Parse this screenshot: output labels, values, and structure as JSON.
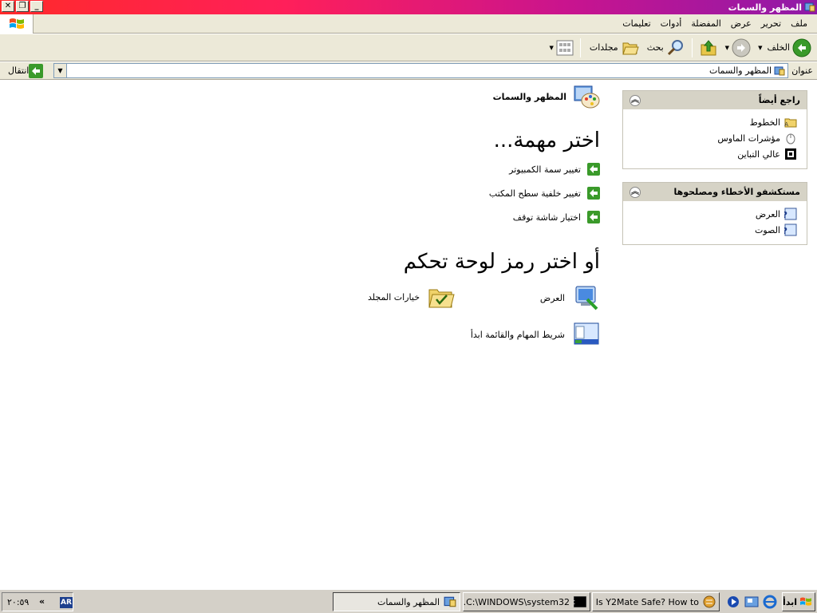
{
  "window": {
    "title": "المظهر والسمات",
    "buttons": [
      "_",
      "❐",
      "✕"
    ]
  },
  "menu": {
    "items": [
      "ملف",
      "تحرير",
      "عرض",
      "المفضلة",
      "أدوات",
      "تعليمات"
    ]
  },
  "toolbar": {
    "back_label": "الخلف",
    "search_label": "بحث",
    "folders_label": "مجلدات"
  },
  "address": {
    "label": "عنوان",
    "value": "المظهر والسمات",
    "go_label": "انتقال"
  },
  "sidebar": {
    "see_also": {
      "title": "راجع أيضاً",
      "items": [
        "الخطوط",
        "مؤشرات الماوس",
        "عالي التباين"
      ]
    },
    "troubleshooters": {
      "title": "مستكشفو الأخطاء ومصلحوها",
      "items": [
        "العرض",
        "الصوت"
      ]
    }
  },
  "main": {
    "category_title": "المظهر والسمات",
    "pick_task": "اختر مهمة...",
    "tasks": [
      "تغيير سمة الكمبيوتر",
      "تغيير خلفية سطح المكتب",
      "اختيار شاشة توقف"
    ],
    "or_pick": "أو اختر رمز لوحة تحكم",
    "icons": [
      "العرض",
      "خيارات المجلد",
      "شريط المهام والقائمة ابدأ"
    ]
  },
  "taskbar": {
    "start_label": "ابدأ",
    "tasks": [
      "Is Y2Mate Safe? How to ...",
      "C:\\WINDOWS\\system32...",
      "المظهر والسمات"
    ],
    "lang": "AR",
    "arrows": "«",
    "clock": "٢٠:٥٩"
  },
  "colors": {
    "title_gradient_start": "#ff2a2a",
    "title_gradient_end": "#8f1aa8",
    "chrome": "#ece9d8",
    "sidebar_header": "#d6d3c6",
    "go_green": "#3a9a2a"
  }
}
